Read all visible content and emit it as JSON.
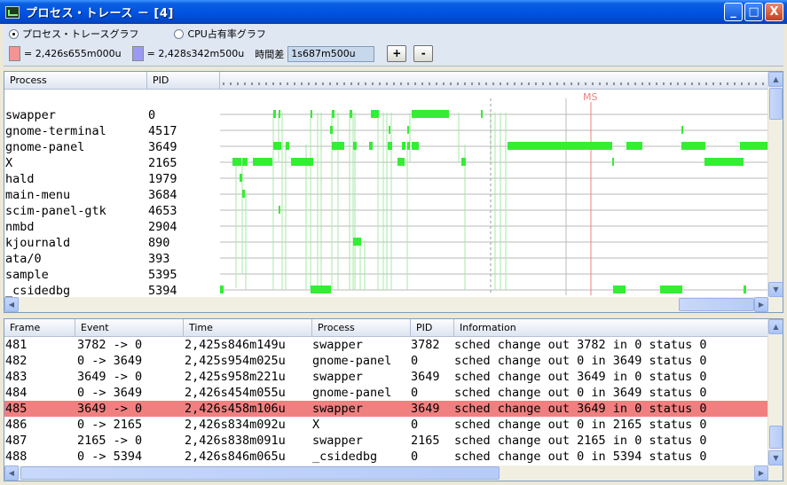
{
  "window": {
    "title": "プロセス・トレース － [4]",
    "minimize_label": "_",
    "maximize_label": "□",
    "close_label": "X"
  },
  "toolbar": {
    "radio_process": "プロセス・トレースグラフ",
    "radio_cpu": "CPU占有率グラフ",
    "cursor1_color": "#f49494",
    "cursor1_label": "= 2,426s655m000u",
    "cursor2_color": "#9a9af4",
    "cursor2_label": "= 2,428s342m500u",
    "time_diff_label": "時間差",
    "time_diff_value": "1s687m500u",
    "plus_label": "+",
    "minus_label": "-"
  },
  "trace": {
    "col_process": "Process",
    "col_pid": "PID",
    "marker_label": "MS",
    "processes": [
      {
        "name": "swapper",
        "pid": "0"
      },
      {
        "name": "gnome-terminal",
        "pid": "4517"
      },
      {
        "name": "gnome-panel",
        "pid": "3649"
      },
      {
        "name": "X",
        "pid": "2165"
      },
      {
        "name": "hald",
        "pid": "1979"
      },
      {
        "name": "main-menu",
        "pid": "3684"
      },
      {
        "name": "scim-panel-gtk",
        "pid": "4653"
      },
      {
        "name": "nmbd",
        "pid": "2904"
      },
      {
        "name": "kjournald",
        "pid": "890"
      },
      {
        "name": "ata/0",
        "pid": "393"
      },
      {
        "name": "sample",
        "pid": "5395"
      },
      {
        "name": "_csidedbg",
        "pid": "5394"
      }
    ]
  },
  "events": {
    "columns": [
      "Frame",
      "Event",
      "Time",
      "Process",
      "PID",
      "Information"
    ],
    "selected_index": 4,
    "rows": [
      {
        "frame": "481",
        "event": "3782 -> 0",
        "time": "2,425s846m149u",
        "process": "swapper",
        "pid": "3782",
        "info": "sched change out 3782 in 0 status 0"
      },
      {
        "frame": "482",
        "event": "0 -> 3649",
        "time": "2,425s954m025u",
        "process": "gnome-panel",
        "pid": "0",
        "info": "sched change out 0 in 3649 status 0"
      },
      {
        "frame": "483",
        "event": "3649 -> 0",
        "time": "2,425s958m221u",
        "process": "swapper",
        "pid": "3649",
        "info": "sched change out 3649 in 0 status 0"
      },
      {
        "frame": "484",
        "event": "0 -> 3649",
        "time": "2,426s454m055u",
        "process": "gnome-panel",
        "pid": "0",
        "info": "sched change out 0 in 3649 status 0"
      },
      {
        "frame": "485",
        "event": "3649 -> 0",
        "time": "2,426s458m106u",
        "process": "swapper",
        "pid": "3649",
        "info": "sched change out 3649 in 0 status 0"
      },
      {
        "frame": "486",
        "event": "0 -> 2165",
        "time": "2,426s834m092u",
        "process": "X",
        "pid": "0",
        "info": "sched change out 0 in 2165 status 0"
      },
      {
        "frame": "487",
        "event": "2165 -> 0",
        "time": "2,426s838m091u",
        "process": "swapper",
        "pid": "2165",
        "info": "sched change out 2165 in 0 status 0"
      },
      {
        "frame": "488",
        "event": "0 -> 5394",
        "time": "2,426s846m065u",
        "process": "_csidedbg",
        "pid": "0",
        "info": "sched change out 0 in 5394 status 0"
      }
    ]
  },
  "colors": {
    "active_bar": "#33ee33",
    "switch_line": "#a6e8a6",
    "cursor_line": "#f08080",
    "selected_row": "#f08080"
  }
}
